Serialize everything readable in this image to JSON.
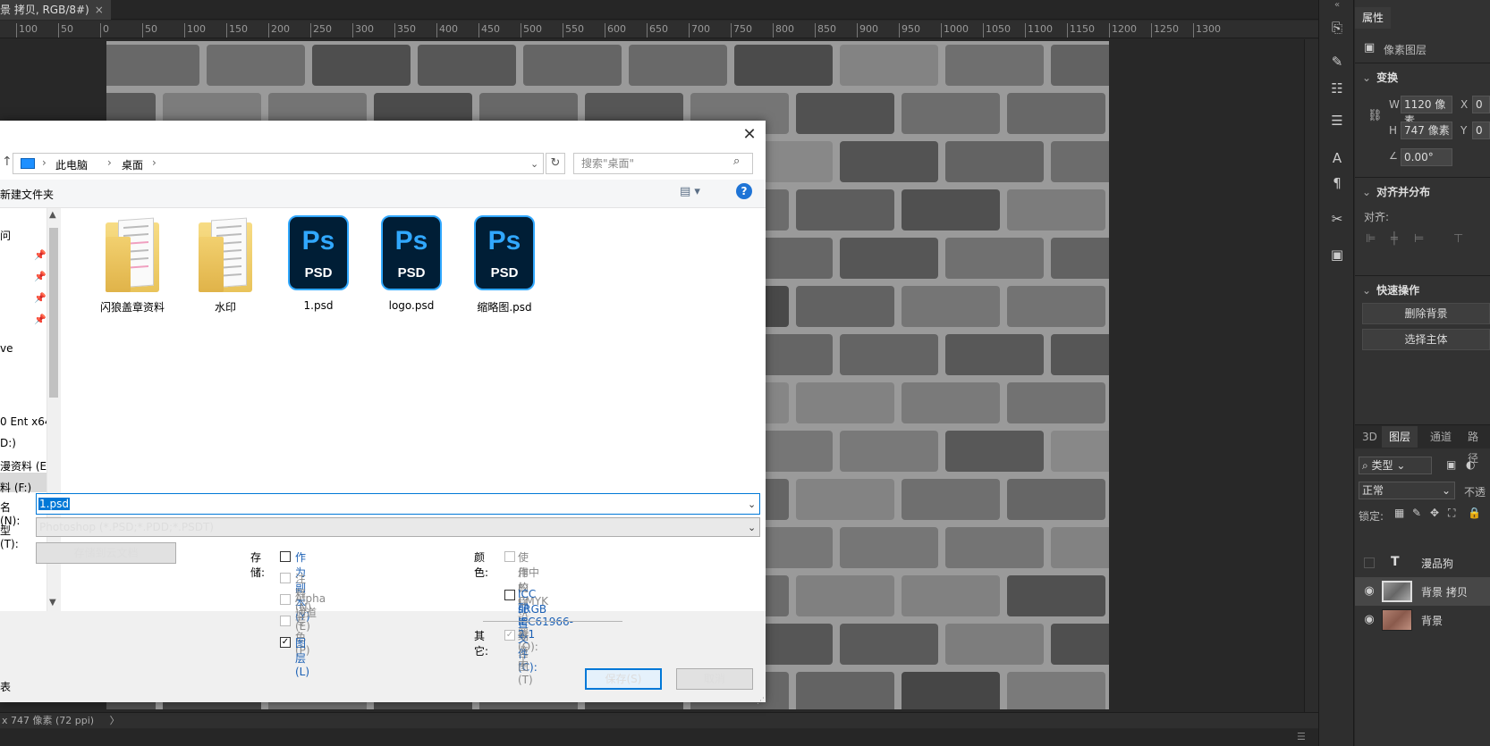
{
  "document": {
    "tab_title": "景 拷贝, RGB/8#)",
    "close_glyph": "×",
    "ruler_ticks": [
      "100",
      "50",
      "0",
      "50",
      "100",
      "150",
      "200",
      "250",
      "300",
      "350",
      "400",
      "450",
      "500",
      "550",
      "600",
      "650",
      "700",
      "750",
      "800",
      "850",
      "900",
      "950",
      "1000",
      "1050",
      "1100",
      "1150",
      "1200",
      "1250",
      "1300"
    ],
    "status": "x 747 像素 (72 ppi)",
    "status_arrow": "〉"
  },
  "right_panel": {
    "properties_tab": "属性",
    "layer_type": "像素图层",
    "transform": {
      "title": "变换",
      "w_label": "W",
      "w_value": "1120 像素",
      "x_label": "X",
      "x_value": "0",
      "h_label": "H",
      "h_value": "747 像素",
      "y_label": "Y",
      "y_value": "0",
      "angle_value": "0.00°"
    },
    "align": {
      "title": "对齐并分布",
      "label": "对齐:"
    },
    "quick_actions": {
      "title": "快速操作",
      "remove_bg": "删除背景",
      "select_subject": "选择主体"
    },
    "layers_tabs": [
      "3D",
      "图层",
      "通道",
      "路径"
    ],
    "filter_kind": "类型",
    "blend_mode": "正常",
    "opacity_label": "不透",
    "lock_label": "锁定:",
    "layers": [
      {
        "name": "漫品狗",
        "type": "text",
        "visible": false
      },
      {
        "name": "背景 拷贝",
        "type": "pixel",
        "visible": true,
        "selected": true
      },
      {
        "name": "背景",
        "type": "pixel",
        "visible": true
      }
    ]
  },
  "dialog": {
    "close": "✕",
    "breadcrumb": [
      "此电脑",
      "桌面"
    ],
    "search_placeholder": "搜索\"桌面\"",
    "new_folder": "新建文件夹",
    "nav_items": [
      {
        "label": "问",
        "pinned": false
      },
      {
        "label": "",
        "pinned": true
      },
      {
        "label": "",
        "pinned": true
      },
      {
        "label": "",
        "pinned": true
      },
      {
        "label": "",
        "pinned": true
      },
      {
        "label": "ve",
        "pinned": false
      },
      {
        "label": "0 Ent x64",
        "pinned": false
      },
      {
        "label": "D:)",
        "pinned": false
      },
      {
        "label": "漫资料 (E",
        "pinned": false
      },
      {
        "label": "料 (F:)",
        "pinned": false
      }
    ],
    "files": [
      {
        "name": "闪狼盖章资料",
        "kind": "folder"
      },
      {
        "name": "水印",
        "kind": "folder"
      },
      {
        "name": "1.psd",
        "kind": "psd"
      },
      {
        "name": "logo.psd",
        "kind": "psd"
      },
      {
        "name": "缩略图.psd",
        "kind": "psd"
      }
    ],
    "ps_icon_text": "Ps",
    "psd_icon_text": "PSD",
    "filename_label": "名(N):",
    "filename_value": "1.psd",
    "filetype_label": "型(T):",
    "filetype_value": "Photoshop (*.PSD;*.PDD;*.PSDT)",
    "cloud_button": "存储到云文档",
    "save_group_label": "存储:",
    "save_options": [
      {
        "label": "作为副本(Y)",
        "checked": false,
        "enabled": true
      },
      {
        "label": "注释(N)",
        "checked": false,
        "enabled": false
      },
      {
        "label": "Alpha 通道(E)",
        "checked": false,
        "enabled": false
      },
      {
        "label": "专色(P)",
        "checked": false,
        "enabled": false
      },
      {
        "label": "图层(L)",
        "checked": true,
        "enabled": true
      }
    ],
    "color_group_label": "颜色:",
    "proof_setup_line1": "使用校样设置(O):  工",
    "proof_setup_line2": "作中的 CMYK",
    "icc_line1": "ICC 配置文件(C):",
    "icc_line2": "sRGB IEC61966-2.1",
    "other_label": "其它:",
    "thumbnail_label": "缩览图(T)",
    "save_button": "保存(S)",
    "cancel_button": "取消",
    "left_edge_label": "表"
  },
  "colors": {
    "accent": "#0078d7",
    "ps_blue": "#31a8ff",
    "ps_dark": "#001e36",
    "folder": "#f2d06f"
  }
}
